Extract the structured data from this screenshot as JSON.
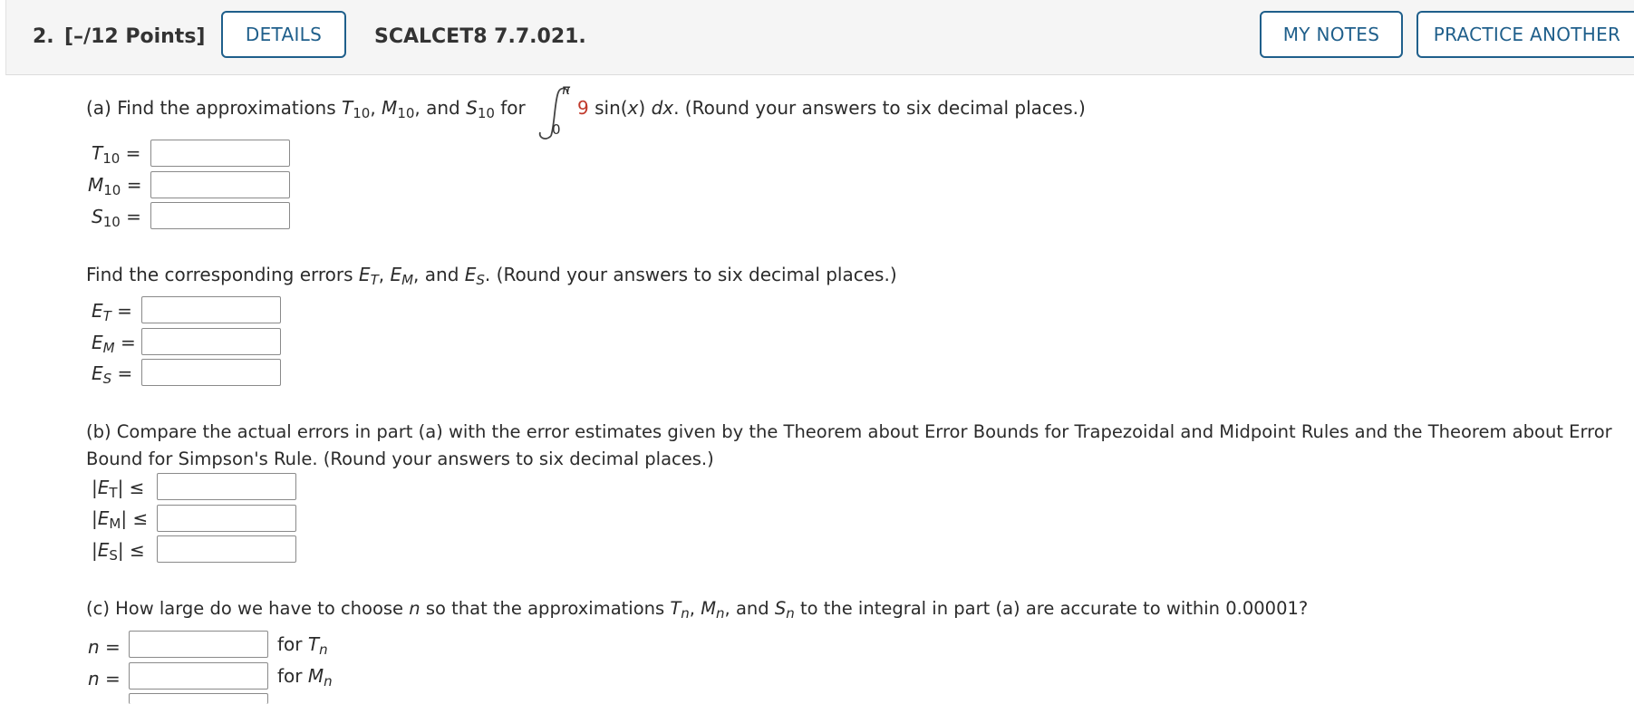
{
  "header": {
    "question_number": "2.",
    "points": "[–/12 Points]",
    "details_button": "DETAILS",
    "problem_code": "SCALCET8 7.7.021.",
    "my_notes_button": "MY NOTES",
    "practice_button": "PRACTICE ANOTHER"
  },
  "part_a": {
    "prefix": "(a) Find the approximations ",
    "T": "T",
    "M": "M",
    "S": "S",
    "sub10": "10",
    "sep1": ", ",
    "sep2": ", and ",
    "for": " for",
    "upper_limit": "π",
    "lower_limit": "0",
    "coef": "9",
    "func": " sin(",
    "var": "x",
    "close": ") ",
    "dx": "dx",
    "suffix": ".  (Round your answers to six decimal places.)",
    "eq": " ="
  },
  "errors": {
    "prefix": "Find the corresponding errors ",
    "E": "E",
    "subT": "T",
    "subM": "M",
    "subS": "S",
    "sep1": ", ",
    "sep2": ", and ",
    "suffix": ". (Round your answers to six decimal places.)",
    "eq": " ="
  },
  "part_b": {
    "line1": "(b) Compare the actual errors in part (a) with the error estimates given by the Theorem about Error Bounds for Trapezoidal and Midpoint Rules and the Theorem about Error",
    "line2": "Bound for Simpson's Rule. (Round your answers to six decimal places.)",
    "bar": "|",
    "E": "E",
    "subT": "T",
    "subM": "M",
    "subS": "S",
    "le": " ≤"
  },
  "part_c": {
    "prefix": "(c) How large do we have to choose ",
    "n": "n",
    "mid": " so that the approximations ",
    "T": "T",
    "M": "M",
    "S": "S",
    "sub_n": "n",
    "sep1": ", ",
    "sep2": ", and ",
    "suffix": " to the integral in part (a) are accurate to within 0.00001?",
    "eq": " =",
    "for": "for "
  }
}
